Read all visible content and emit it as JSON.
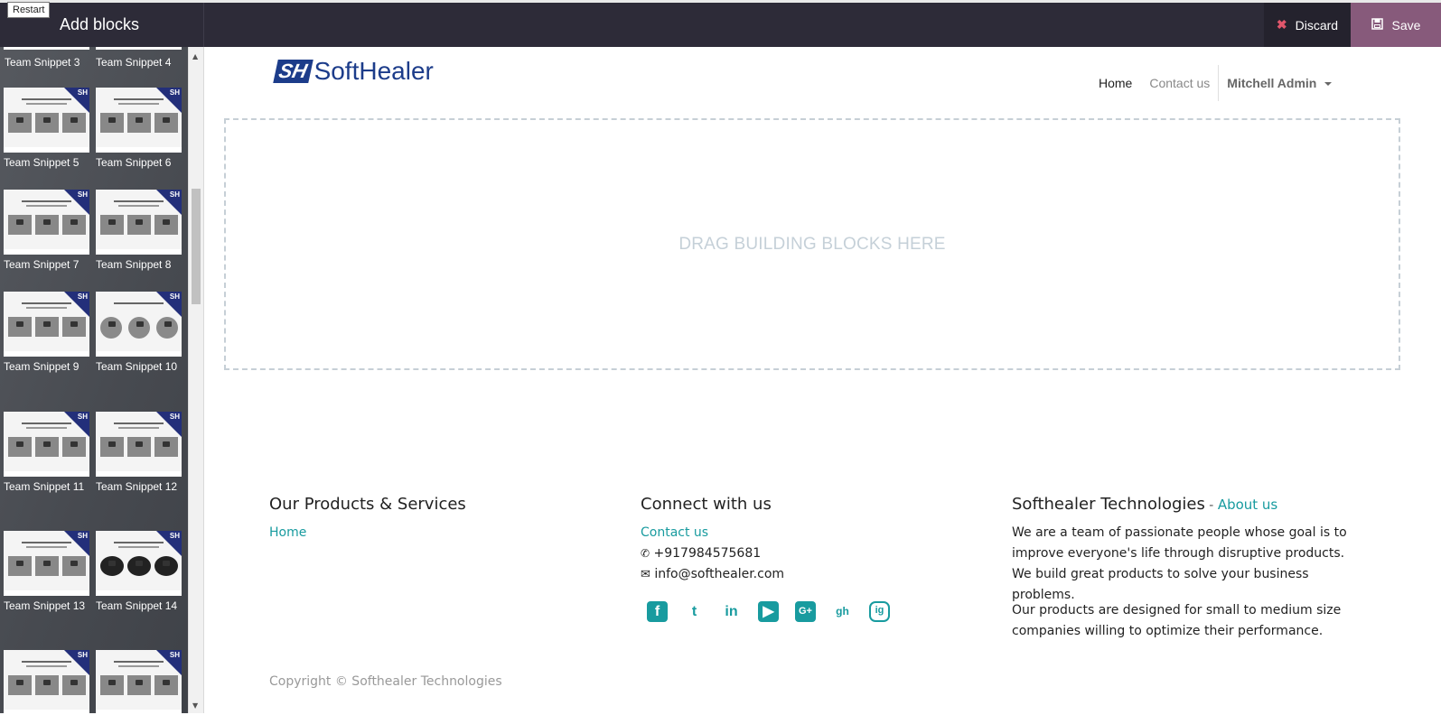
{
  "topbar": {
    "restart_label": "Restart",
    "title": "Add blocks",
    "discard_label": "Discard",
    "save_label": "Save"
  },
  "sidebar": {
    "snippets": [
      {
        "label": "Team Snippet 3"
      },
      {
        "label": "Team Snippet 4"
      },
      {
        "label": "Team Snippet 5"
      },
      {
        "label": "Team Snippet 6"
      },
      {
        "label": "Team Snippet 7"
      },
      {
        "label": "Team Snippet 8"
      },
      {
        "label": "Team Snippet 9"
      },
      {
        "label": "Team Snippet 10"
      },
      {
        "label": "Team Snippet 11"
      },
      {
        "label": "Team Snippet 12"
      },
      {
        "label": "Team Snippet 13"
      },
      {
        "label": "Team Snippet 14"
      }
    ],
    "badge": "SH"
  },
  "header": {
    "logo_mark": "SH",
    "logo_text": "SoftHealer",
    "nav": {
      "home": "Home",
      "contact": "Contact us",
      "user": "Mitchell Admin"
    }
  },
  "dropzone": {
    "text": "DRAG BUILDING BLOCKS HERE"
  },
  "footer": {
    "col1": {
      "title": "Our Products & Services",
      "link": "Home"
    },
    "col2": {
      "title": "Connect with us",
      "link": "Contact us",
      "phone": "+917984575681",
      "email": "info@softhealer.com",
      "social": [
        "f",
        "t",
        "in",
        "▶",
        "G+",
        "gh",
        "ig"
      ]
    },
    "col3": {
      "title": "Softhealer Technologies",
      "sep": " - ",
      "link": "About us",
      "p1": "We are a team of passionate people whose goal is to improve everyone's life through disruptive products. We build great products to solve your business problems.",
      "p2": "Our products are designed for small to medium size companies willing to optimize their performance."
    },
    "copyright": "Copyright © Softhealer Technologies"
  },
  "colors": {
    "topbar": "#2d2b38",
    "save": "#875a7b",
    "teal": "#189b9f",
    "logo": "#1c3c8a"
  }
}
